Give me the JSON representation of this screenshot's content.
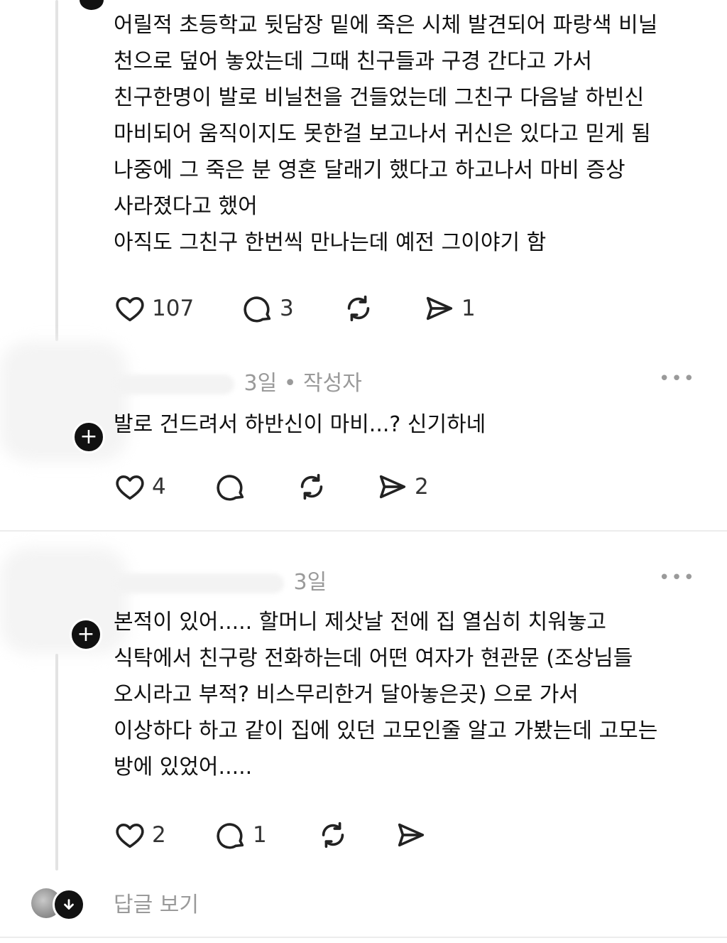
{
  "post": {
    "lines": [
      "어릴적 초등학교 뒷담장 밑에 죽은 시체 발견되어 파랑색 비닐",
      "천으로 덮어 놓았는데 그때 친구들과 구경 간다고 가서",
      "친구한명이 발로 비닐천을 건들었는데 그친구 다음날 하빈신",
      "마비되어 움직이지도 못한걸 보고나서 귀신은 있다고 믿게 됨",
      "나중에 그 죽은 분 영혼 달래기 했다고 하고나서 마비 증상",
      "사라졌다고 했어",
      "아직도 그친구 한번씩 만나는데 예전 그이야기 함"
    ],
    "likes": "107",
    "comments": "3",
    "shares": "1"
  },
  "reply1": {
    "time": "3일",
    "separator": "•",
    "author_tag": "작성자",
    "text": "발로 건드려서 하반신이 마비...? 신기하네",
    "likes": "4",
    "shares": "2",
    "more": "•••"
  },
  "reply2": {
    "time": "3일",
    "lines": [
      "본적이 있어..... 할머니 제삿날 전에 집 열심히 치워놓고",
      "식탁에서 친구랑 전화하는데 어떤 여자가 현관문 (조상님들",
      "오시라고 부적? 비스무리한거 달아놓은곳) 으로 가서",
      "이상하다 하고 같이 집에 있던 고모인줄 알고 가봤는데 고모는",
      "방에 있었어....."
    ],
    "likes": "2",
    "comments": "1",
    "more": "•••"
  },
  "view_replies_label": "답글 보기",
  "icons": {
    "like": "heart-icon",
    "comment": "comment-bubble-icon",
    "repost": "repost-icon",
    "share": "share-send-icon",
    "plus": "plus-icon",
    "down": "arrow-down-icon"
  }
}
